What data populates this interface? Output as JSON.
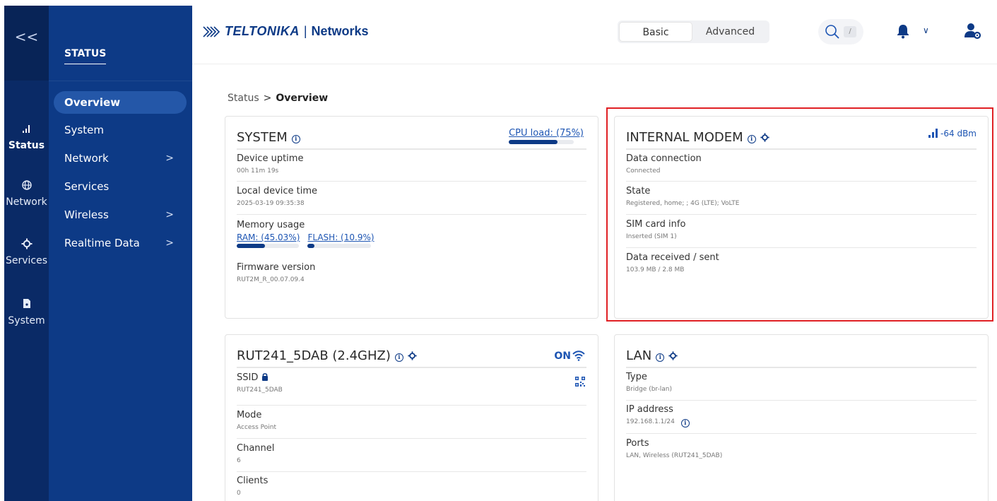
{
  "rail": {
    "collapse_label": "<<",
    "items": [
      {
        "label": "Status",
        "icon": "signal-icon",
        "active": true
      },
      {
        "label": "Network",
        "icon": "globe-icon"
      },
      {
        "label": "Services",
        "icon": "gear-icon"
      },
      {
        "label": "System",
        "icon": "file-icon"
      }
    ]
  },
  "sidebar": {
    "title": "STATUS",
    "items": [
      {
        "label": "Overview",
        "active": true
      },
      {
        "label": "System"
      },
      {
        "label": "Network",
        "chevron": ">"
      },
      {
        "label": "Services"
      },
      {
        "label": "Wireless",
        "chevron": ">"
      },
      {
        "label": "Realtime Data",
        "chevron": ">"
      }
    ]
  },
  "header": {
    "brand": "TELTONIKA",
    "separator": "|",
    "product": "Networks",
    "mode_basic": "Basic",
    "mode_advanced": "Advanced",
    "search_shortcut": "/",
    "bell_chevron": "∨"
  },
  "breadcrumb": {
    "parent": "Status",
    "separator": ">",
    "current": "Overview"
  },
  "system_card": {
    "title": "SYSTEM",
    "cpu_label": "CPU load: (75%)",
    "cpu_percent": 75,
    "uptime_label": "Device uptime",
    "uptime_value": "00h 11m 19s",
    "time_label": "Local device time",
    "time_value": "2025-03-19 09:35:38",
    "memory_label": "Memory usage",
    "ram_label": "RAM: (45.03%)",
    "ram_percent": 45.03,
    "flash_label": "FLASH: (10.9%)",
    "flash_percent": 10.9,
    "firmware_label": "Firmware version",
    "firmware_value": "RUT2M_R_00.07.09.4"
  },
  "modem_card": {
    "title": "INTERNAL MODEM",
    "signal": "-64 dBm",
    "data_conn_label": "Data connection",
    "data_conn_value": "Connected",
    "state_label": "State",
    "state_value": "Registered, home; ; 4G (LTE); VoLTE",
    "sim_label": "SIM card info",
    "sim_value": "Inserted (SIM 1)",
    "data_label": "Data received / sent",
    "data_value": "103.9 MB / 2.8 MB"
  },
  "wifi_card": {
    "title": "RUT241_5DAB (2.4GHZ)",
    "status": "ON",
    "ssid_label": "SSID",
    "ssid_value": "RUT241_5DAB",
    "mode_label": "Mode",
    "mode_value": "Access Point",
    "channel_label": "Channel",
    "channel_value": "6",
    "clients_label": "Clients",
    "clients_value": "0"
  },
  "lan_card": {
    "title": "LAN",
    "type_label": "Type",
    "type_value": "Bridge (br-lan)",
    "ip_label": "IP address",
    "ip_value": "192.168.1.1/24",
    "ports_label": "Ports",
    "ports_value": "LAN, Wireless (RUT241_5DAB)"
  },
  "colors": {
    "rail": "#0a2a66",
    "sidebar": "#0d3a86",
    "accent": "#1d55b3",
    "highlight_box": "#e02024"
  }
}
